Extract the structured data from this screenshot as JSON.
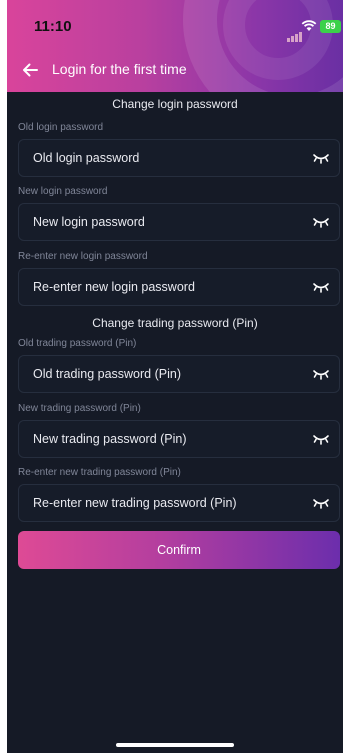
{
  "status_bar": {
    "time": "11:10",
    "battery": "89"
  },
  "nav": {
    "title": "Login for the first time"
  },
  "sections": {
    "login": "Change login password",
    "trading": "Change trading password (Pin)"
  },
  "fields": [
    {
      "label": "Old login password",
      "placeholder": "Old login password"
    },
    {
      "label": "New login password",
      "placeholder": "New login password"
    },
    {
      "label": "Re-enter new login password",
      "placeholder": "Re-enter new login password"
    },
    {
      "label": "Old trading password (Pin)",
      "placeholder": "Old trading password (Pin)"
    },
    {
      "label": "New trading password (Pin)",
      "placeholder": "New trading password (Pin)"
    },
    {
      "label": "Re-enter new trading password (Pin)",
      "placeholder": "Re-enter new trading password (Pin)"
    }
  ],
  "confirm_label": "Confirm",
  "icons": {
    "back": "arrow-left-icon",
    "visibility": "eye-closed-icon"
  },
  "colors": {
    "background": "#151a26",
    "header_start": "#d9449b",
    "header_end": "#6a2fa3",
    "button_start": "#de4a95",
    "button_end": "#6c2eac"
  }
}
